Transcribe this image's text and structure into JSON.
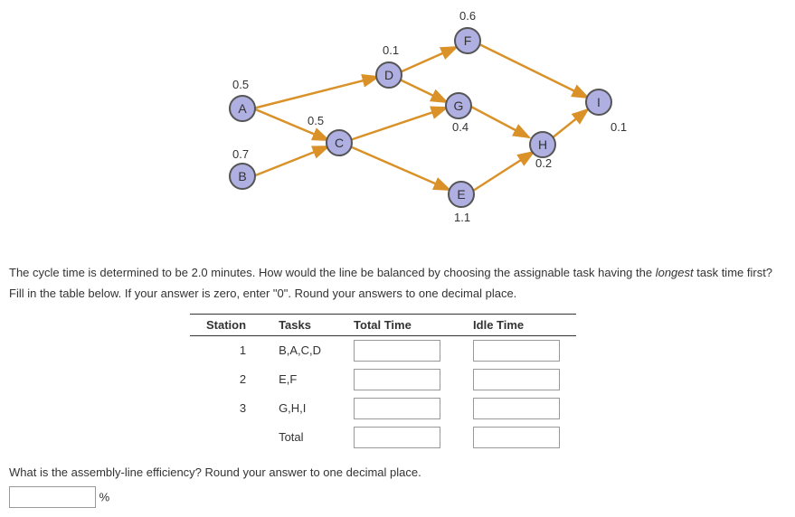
{
  "diagram": {
    "nodes": {
      "A": "A",
      "B": "B",
      "C": "C",
      "D": "D",
      "E": "E",
      "F": "F",
      "G": "G",
      "H": "H",
      "I": "I"
    },
    "labels": {
      "AD": "0.5",
      "BC": "0.7",
      "AC": "0.5",
      "DF": "0.1",
      "DG_F": "0.6",
      "CG": "0.4",
      "CE": "1.1",
      "EH": "0.2",
      "HI": "0.1"
    }
  },
  "question": {
    "p1a": "The cycle time is determined to be 2.0 minutes. How would the line be balanced by choosing the assignable task having the ",
    "p1b": "longest",
    "p1c": " task time first? Fill in the table below. If your answer is zero, enter \"0\". Round your answers to one decimal place.",
    "p2": "What is the assembly-line efficiency? Round your answer to one decimal place.",
    "percent": "%"
  },
  "table": {
    "headers": {
      "station": "Station",
      "tasks": "Tasks",
      "total": "Total Time",
      "idle": "Idle Time"
    },
    "rows": [
      {
        "station": "1",
        "tasks": "B,A,C,D"
      },
      {
        "station": "2",
        "tasks": "E,F"
      },
      {
        "station": "3",
        "tasks": "G,H,I"
      },
      {
        "station": "",
        "tasks": "Total"
      }
    ]
  }
}
